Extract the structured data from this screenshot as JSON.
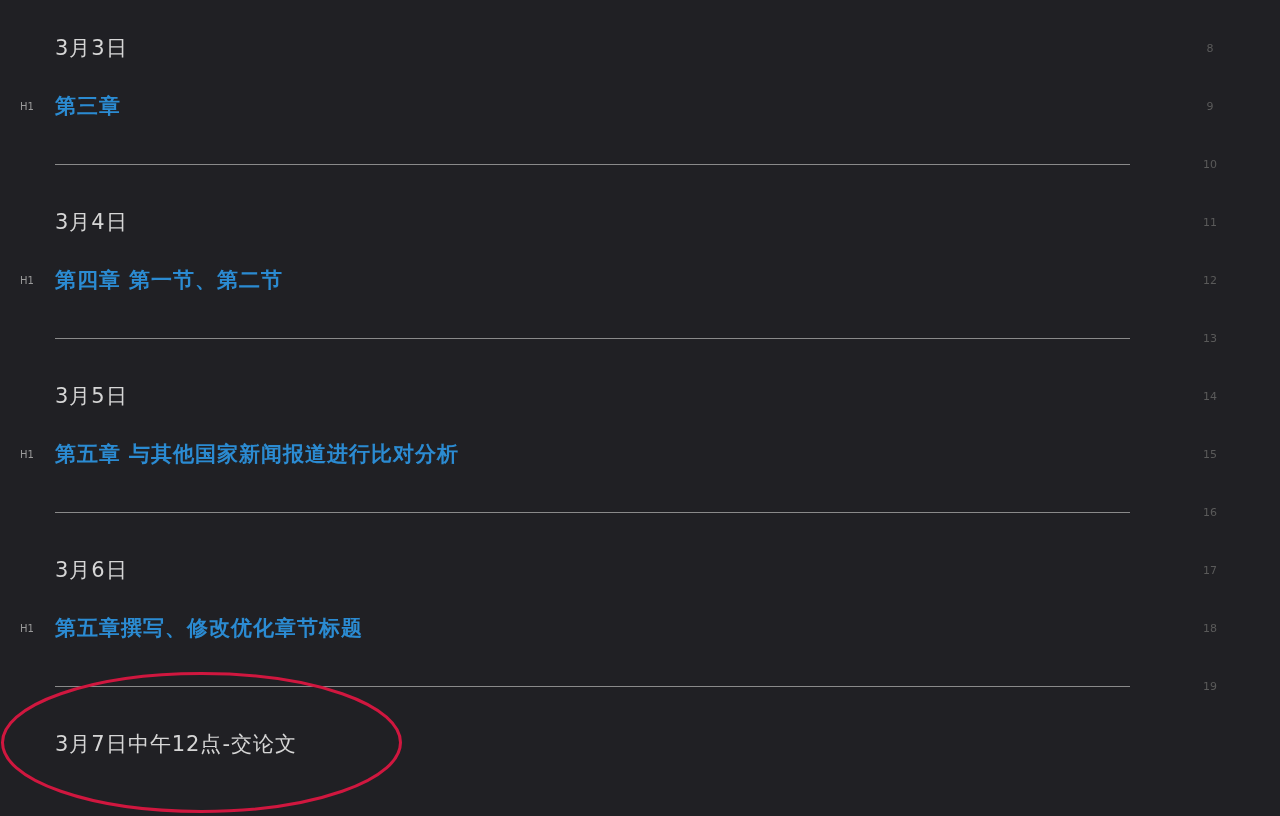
{
  "lines": [
    {
      "kind": "date",
      "number": "8",
      "text": "3月3日",
      "circled": false
    },
    {
      "kind": "heading",
      "number": "9",
      "marker": "H1",
      "text": "第三章",
      "circled": false
    },
    {
      "kind": "rule",
      "number": "10",
      "circled": false
    },
    {
      "kind": "date",
      "number": "11",
      "text": "3月4日",
      "circled": false
    },
    {
      "kind": "heading",
      "number": "12",
      "marker": "H1",
      "text": "第四章 第一节、第二节",
      "circled": false
    },
    {
      "kind": "rule",
      "number": "13",
      "circled": false
    },
    {
      "kind": "date",
      "number": "14",
      "text": "3月5日",
      "circled": false
    },
    {
      "kind": "heading",
      "number": "15",
      "marker": "H1",
      "text": "第五章 与其他国家新闻报道进行比对分析",
      "circled": false
    },
    {
      "kind": "rule",
      "number": "16",
      "circled": false
    },
    {
      "kind": "date",
      "number": "17",
      "text": "3月6日",
      "circled": false
    },
    {
      "kind": "heading",
      "number": "18",
      "marker": "H1",
      "text": "第五章撰写、修改优化章节标题",
      "circled": false
    },
    {
      "kind": "rule",
      "number": "19",
      "circled": false
    },
    {
      "kind": "date",
      "text": "3月7日中午12点-交论文",
      "circled": true
    }
  ]
}
